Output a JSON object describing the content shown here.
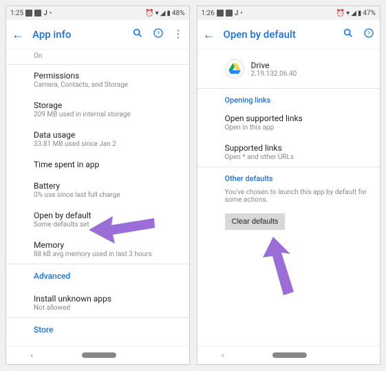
{
  "left": {
    "status": {
      "time": "1:25",
      "battery": "48%"
    },
    "header": {
      "title": "App info"
    },
    "rows": {
      "on": {
        "title": "On"
      },
      "permissions": {
        "title": "Permissions",
        "sub": "Camera, Contacts, and Storage"
      },
      "storage": {
        "title": "Storage",
        "sub": "209 MB used in internal storage"
      },
      "datausage": {
        "title": "Data usage",
        "sub": "33.81 MB used since Jan 2"
      },
      "timespent": {
        "title": "Time spent in app"
      },
      "battery": {
        "title": "Battery",
        "sub": "0% use since last full charge"
      },
      "openbydefault": {
        "title": "Open by default",
        "sub": "Some defaults set"
      },
      "memory": {
        "title": "Memory",
        "sub": "88 kB avg memory used in last 3 hours"
      },
      "advanced": "Advanced",
      "installunknown": {
        "title": "Install unknown apps",
        "sub": "Not allowed"
      },
      "store": "Store"
    }
  },
  "right": {
    "status": {
      "time": "1:26",
      "battery": "47%"
    },
    "header": {
      "title": "Open by default"
    },
    "app": {
      "name": "Drive",
      "version": "2.19.132.06.40"
    },
    "sections": {
      "openinglinks": "Opening links",
      "opensupported": {
        "title": "Open supported links",
        "sub": "Open in this app"
      },
      "supportedlinks": {
        "title": "Supported links",
        "sub": "Open * and other URLs"
      },
      "otherdefaults": "Other defaults",
      "desc": "You've chosen to launch this app by default for some actions.",
      "clear": "Clear defaults"
    }
  }
}
